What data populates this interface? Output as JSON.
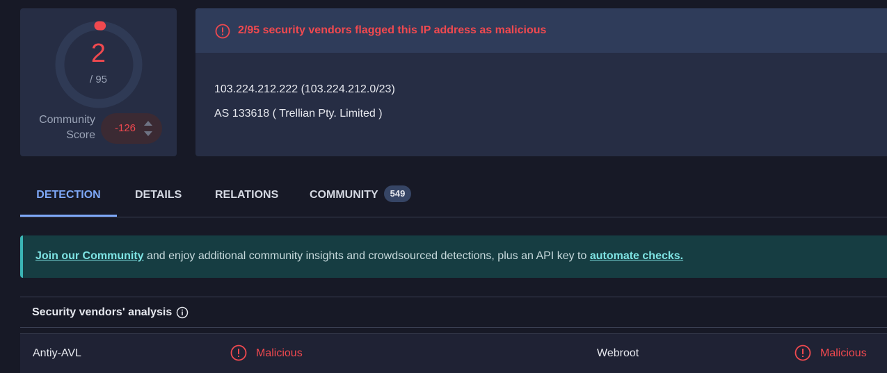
{
  "score": {
    "detections": "2",
    "total": "/ 95",
    "detection_fraction": 0.021,
    "community_label_line1": "Community",
    "community_label_line2": "Score",
    "community_value": "-126"
  },
  "alert": {
    "icon": "alert-circle-icon",
    "text": "2/95 security vendors flagged this IP address as malicious"
  },
  "ip_info": {
    "ip_line": "103.224.212.222  (103.224.212.0/23)",
    "as_line": "AS 133618  ( Trellian Pty. Limited )"
  },
  "tabs": [
    {
      "label": "DETECTION",
      "active": true
    },
    {
      "label": "DETAILS",
      "active": false
    },
    {
      "label": "RELATIONS",
      "active": false
    },
    {
      "label": "COMMUNITY",
      "active": false,
      "badge": "549"
    }
  ],
  "banner": {
    "link1": "Join our Community",
    "middle": " and enjoy additional community insights and crowdsourced detections, plus an API key to ",
    "link2": "automate checks."
  },
  "vendors": {
    "title": "Security vendors' analysis",
    "rows": [
      {
        "name": "Antiy-AVL",
        "verdict": "Malicious"
      },
      {
        "name": "Webroot",
        "verdict": "Malicious"
      }
    ]
  },
  "colors": {
    "malicious": "#f0494f",
    "accent": "#7ea8f7",
    "banner_link": "#7ee3e3"
  }
}
